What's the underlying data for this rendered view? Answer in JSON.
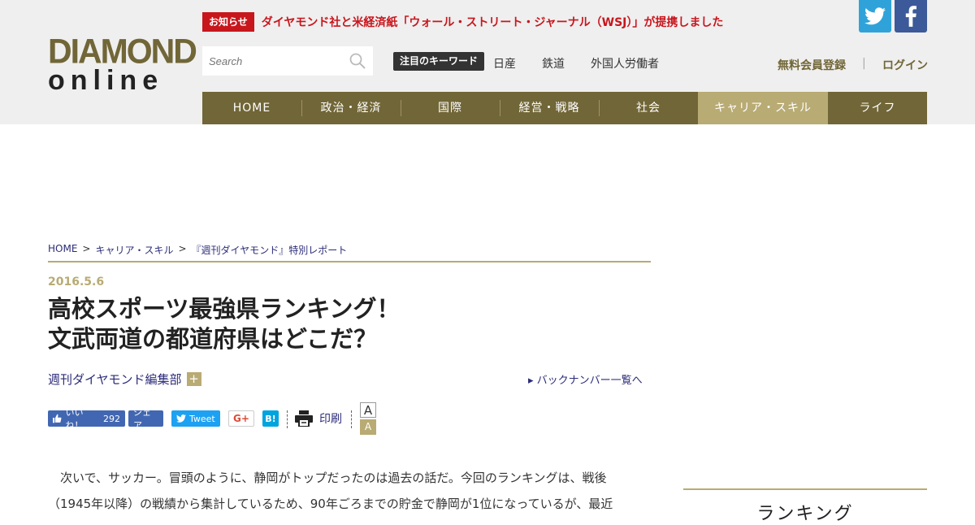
{
  "logo": {
    "line1": "DIAMOND",
    "line2": "online"
  },
  "notice": {
    "badge": "お知らせ",
    "text": "ダイヤモンド社と米経済紙「ウォール・ストリート・ジャーナル（WSJ）」が提携しました"
  },
  "search": {
    "placeholder": "Search"
  },
  "keywords": {
    "label": "注目のキーワード",
    "items": [
      "日産",
      "鉄道",
      "外国人労働者"
    ]
  },
  "account": {
    "register": "無料会員登録",
    "separator": "|",
    "login": "ログイン"
  },
  "nav": {
    "items": [
      "HOME",
      "政治・経済",
      "国際",
      "経営・戦略",
      "社会",
      "キャリア・スキル",
      "ライフ"
    ],
    "active_index": 5
  },
  "breadcrumb": {
    "items": [
      "HOME",
      "キャリア・スキル",
      "『週刊ダイヤモンド』特別レポート"
    ],
    "separator": ">"
  },
  "article": {
    "date": "2016.5.6",
    "title_line1": "高校スポーツ最強県ランキング！",
    "title_line2": "文武両道の都道府県はどこだ？",
    "author": "週刊ダイヤモンド編集部",
    "author_plus": "+",
    "backnumber": "▸ バックナンバー一覧へ",
    "body_line1": "次いで、サッカー。冒頭のように、静岡がトップだったのは過去の話だ。今回のランキングは、戦後",
    "body_line2": "（1945年以降）の戦績から集計しているため、90年ごろまでの貯金で静岡が1位になっているが、最近"
  },
  "share": {
    "like_label": "いいね！",
    "like_count": "292",
    "fb_share": "シェア",
    "tweet": "Tweet",
    "gplus": "G+",
    "hatena": "B!",
    "print": "印刷",
    "font_a": "A",
    "font_b": "A"
  },
  "sidebar": {
    "ranking_title": "ランキング"
  },
  "colors": {
    "brand": "#716637",
    "brand_light": "#b8ab74",
    "notice_red": "#c8161d",
    "link": "#2c2c7a",
    "twitter": "#2fa3d9",
    "facebook": "#3c5a99"
  }
}
